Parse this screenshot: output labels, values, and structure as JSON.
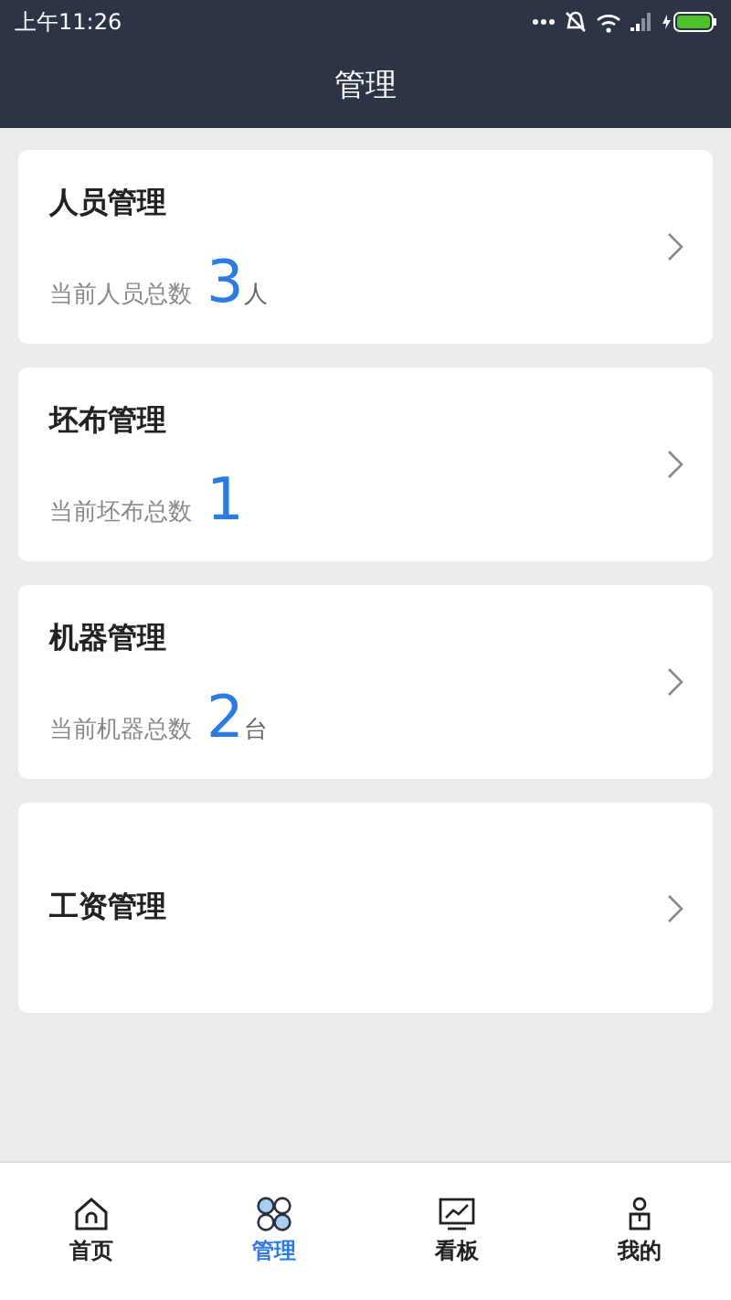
{
  "status_bar": {
    "time": "上午11:26"
  },
  "header": {
    "title": "管理"
  },
  "cards": [
    {
      "title": "人员管理",
      "stat_label": "当前人员总数",
      "stat_value": "3",
      "stat_unit": "人"
    },
    {
      "title": "坯布管理",
      "stat_label": "当前坯布总数",
      "stat_value": "1"
    },
    {
      "title": "机器管理",
      "stat_label": "当前机器总数",
      "stat_value": "2",
      "stat_unit": "台"
    },
    {
      "title": "工资管理"
    }
  ],
  "tab_bar": [
    {
      "label": "首页",
      "selected": false
    },
    {
      "label": "管理",
      "selected": true
    },
    {
      "label": "看板",
      "selected": false
    },
    {
      "label": "我的",
      "selected": false
    }
  ]
}
